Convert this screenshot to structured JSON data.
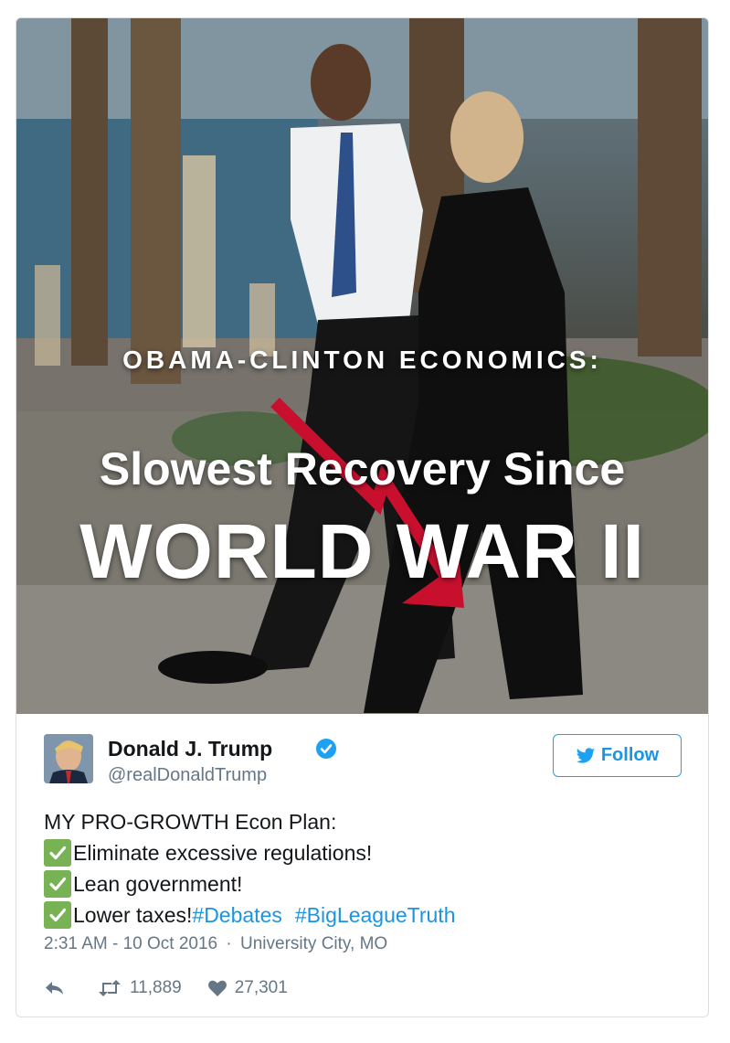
{
  "image": {
    "line1": "OBAMA-CLINTON ECONOMICS:",
    "line2": "Slowest Recovery Since",
    "line3": "WORLD WAR II",
    "arrow_color": "#c8102e"
  },
  "author": {
    "name": "Donald J. Trump",
    "handle": "@realDonaldTrump",
    "verified_color": "#1da1f2"
  },
  "follow_button": {
    "label": "Follow"
  },
  "tweet": {
    "heading": "MY PRO-GROWTH Econ Plan:",
    "items": [
      "Eliminate excessive regulations!",
      "Lean government!",
      "Lower taxes!"
    ],
    "hashtags": [
      "#Debates",
      "#BigLeagueTruth"
    ]
  },
  "meta": {
    "time": "2:31 AM - 10 Oct 2016",
    "separator": "·",
    "location": "University City, MO"
  },
  "stats": {
    "retweets": "11,889",
    "likes": "27,301"
  },
  "colors": {
    "accent": "#1da1f2",
    "check_green": "#77b255",
    "text": "#14171a",
    "muted": "#657786"
  }
}
